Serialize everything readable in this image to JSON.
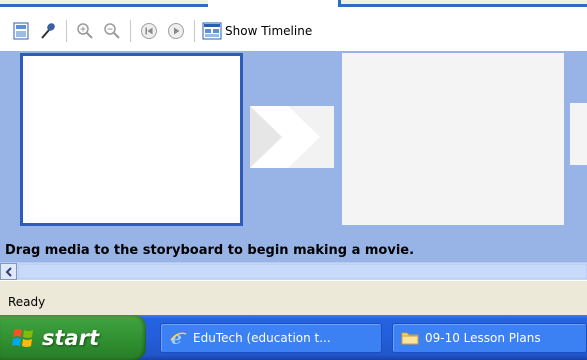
{
  "toolbar": {
    "show_timeline_label": "Show Timeline"
  },
  "storyboard": {
    "hint": "Drag media to the storyboard to begin making a movie."
  },
  "status": {
    "text": "Ready"
  },
  "taskbar": {
    "start_label": "start",
    "tasks": [
      {
        "label": "EduTech (education t...",
        "icon": "ie-icon"
      },
      {
        "label": "09-10 Lesson Plans",
        "icon": "folder-icon"
      }
    ]
  },
  "colors": {
    "storyboard_bg": "#98b4e6",
    "selected_frame_border": "#2f5bbd",
    "taskbar_blue": "#245edb",
    "start_green": "#3c9e3c"
  }
}
